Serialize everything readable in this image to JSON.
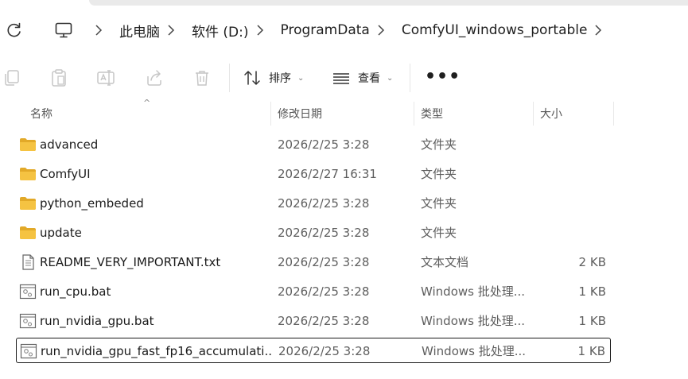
{
  "breadcrumb": [
    "此电脑",
    "软件 (D:)",
    "ProgramData",
    "ComfyUI_windows_portable"
  ],
  "toolbar": {
    "sort_label": "排序",
    "view_label": "查看",
    "more_label": "•••"
  },
  "columns": {
    "name": "名称",
    "date": "修改日期",
    "type": "类型",
    "size": "大小"
  },
  "rows": [
    {
      "name": "advanced",
      "date": "2026/2/25 3:28",
      "type": "文件夹",
      "size": "",
      "icon": "folder-icon"
    },
    {
      "name": "ComfyUI",
      "date": "2026/2/27 16:31",
      "type": "文件夹",
      "size": "",
      "icon": "folder-icon"
    },
    {
      "name": "python_embeded",
      "date": "2026/2/25 3:28",
      "type": "文件夹",
      "size": "",
      "icon": "folder-icon"
    },
    {
      "name": "update",
      "date": "2026/2/25 3:28",
      "type": "文件夹",
      "size": "",
      "icon": "folder-icon"
    },
    {
      "name": "README_VERY_IMPORTANT.txt",
      "date": "2026/2/25 3:28",
      "type": "文本文档",
      "size": "2 KB",
      "icon": "text-file-icon"
    },
    {
      "name": "run_cpu.bat",
      "date": "2026/2/25 3:28",
      "type": "Windows 批处理...",
      "size": "1 KB",
      "icon": "batch-file-icon"
    },
    {
      "name": "run_nvidia_gpu.bat",
      "date": "2026/2/25 3:28",
      "type": "Windows 批处理...",
      "size": "1 KB",
      "icon": "batch-file-icon"
    },
    {
      "name": "run_nvidia_gpu_fast_fp16_accumulati...",
      "date": "2026/2/25 3:28",
      "type": "Windows 批处理...",
      "size": "1 KB",
      "icon": "batch-file-icon"
    }
  ],
  "colors": {
    "folder": "#F5C342",
    "folder_dark": "#E2A928",
    "selection_border": "#1a1a1a"
  }
}
